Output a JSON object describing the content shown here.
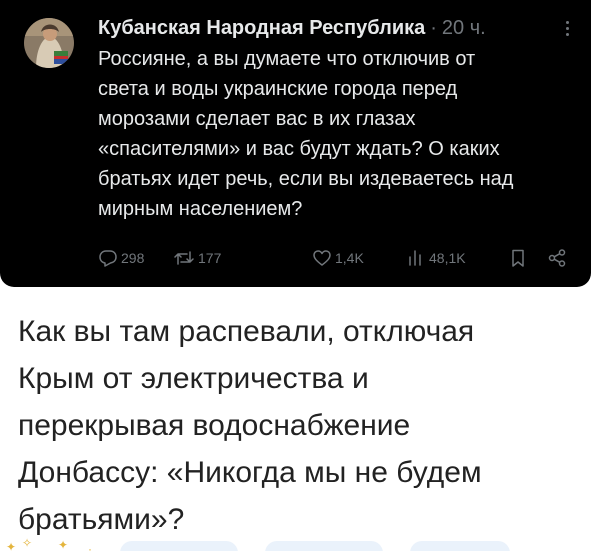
{
  "post": {
    "author": "Кубанская Народная Республика",
    "separator": "·",
    "time": "20 ч.",
    "text_lines": [
      "Россияне, а вы думаете что отключив  от",
      "света и воды украинские города перед",
      "морозами сделает вас в их глазах",
      "«спасителями» и вас будут ждать? О каких",
      "братьях идет речь, если вы издеваетесь над",
      "мирным населением?"
    ],
    "actions": {
      "replies": "298",
      "retweets": "177",
      "likes": "1,4K",
      "views": "48,1K"
    },
    "icons": [
      "reply-icon",
      "retweet-icon",
      "like-icon",
      "views-icon",
      "bookmark-icon",
      "share-icon",
      "more-icon"
    ]
  },
  "caption_lines": [
    "Как вы там распевали, отключая",
    "Крым от электричества и",
    "перекрывая водоснабжение",
    "Донбассу: «Никогда мы не будем",
    "братьями»?"
  ],
  "colors": {
    "card_background": "#000000",
    "primary_text": "#e7e9ea",
    "secondary_text": "#71767b",
    "page_background": "#ffffff",
    "caption_text": "#222222"
  }
}
